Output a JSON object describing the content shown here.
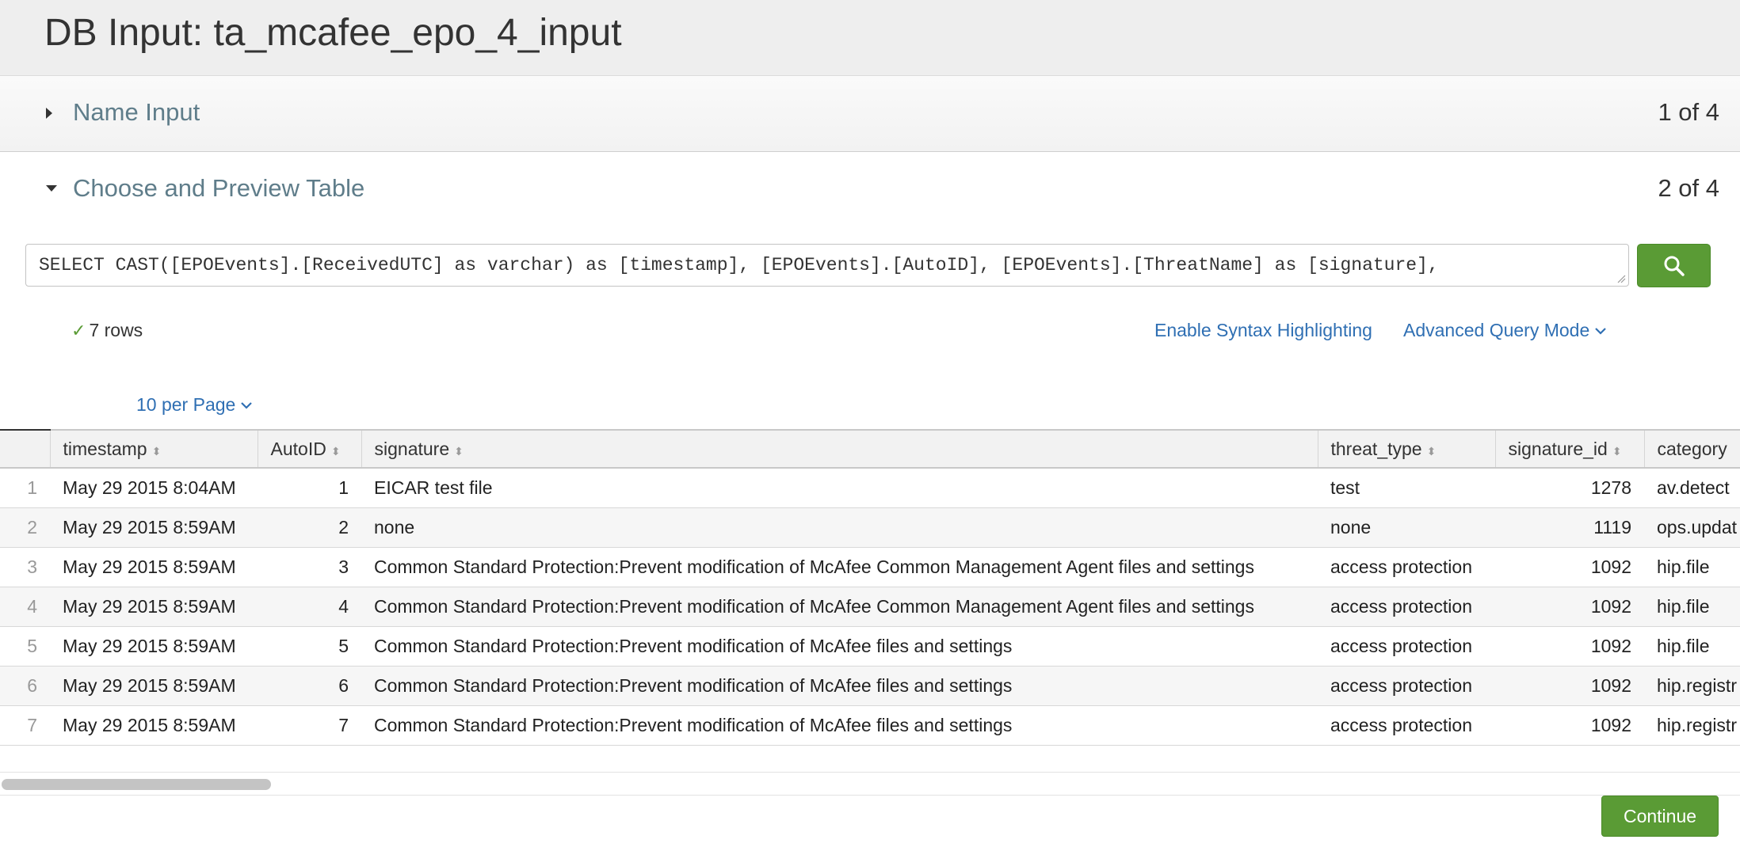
{
  "page": {
    "title": "DB Input: ta_mcafee_epo_4_input"
  },
  "sections": [
    {
      "title": "Name Input",
      "step": "1 of 4",
      "expanded": false
    },
    {
      "title": "Choose and Preview Table",
      "step": "2 of 4",
      "expanded": true
    }
  ],
  "query": {
    "text": "SELECT CAST([EPOEvents].[ReceivedUTC] as varchar) as [timestamp], [EPOEvents].[AutoID], [EPOEvents].[ThreatName] as [signature],",
    "search_icon": "search-icon"
  },
  "status": {
    "rows": "7 rows",
    "icon": "check-icon"
  },
  "links": {
    "syntax": "Enable Syntax Highlighting",
    "advanced": "Advanced Query Mode",
    "per_page": "10 per Page"
  },
  "table": {
    "columns": [
      "timestamp",
      "AutoID",
      "signature",
      "threat_type",
      "signature_id",
      "category"
    ],
    "rows": [
      {
        "n": "1",
        "timestamp": "May 29 2015 8:04AM",
        "autoid": "1",
        "signature": "EICAR test file",
        "threat_type": "test",
        "signature_id": "1278",
        "category": "av.detect"
      },
      {
        "n": "2",
        "timestamp": "May 29 2015 8:59AM",
        "autoid": "2",
        "signature": "none",
        "threat_type": "none",
        "signature_id": "1119",
        "category": "ops.updat"
      },
      {
        "n": "3",
        "timestamp": "May 29 2015 8:59AM",
        "autoid": "3",
        "signature": "Common Standard Protection:Prevent modification of McAfee Common Management Agent files and settings",
        "threat_type": "access protection",
        "signature_id": "1092",
        "category": "hip.file"
      },
      {
        "n": "4",
        "timestamp": "May 29 2015 8:59AM",
        "autoid": "4",
        "signature": "Common Standard Protection:Prevent modification of McAfee Common Management Agent files and settings",
        "threat_type": "access protection",
        "signature_id": "1092",
        "category": "hip.file"
      },
      {
        "n": "5",
        "timestamp": "May 29 2015 8:59AM",
        "autoid": "5",
        "signature": "Common Standard Protection:Prevent modification of McAfee files and settings",
        "threat_type": "access protection",
        "signature_id": "1092",
        "category": "hip.file"
      },
      {
        "n": "6",
        "timestamp": "May 29 2015 8:59AM",
        "autoid": "6",
        "signature": "Common Standard Protection:Prevent modification of McAfee files and settings",
        "threat_type": "access protection",
        "signature_id": "1092",
        "category": "hip.registr"
      },
      {
        "n": "7",
        "timestamp": "May 29 2015 8:59AM",
        "autoid": "7",
        "signature": "Common Standard Protection:Prevent modification of McAfee files and settings",
        "threat_type": "access protection",
        "signature_id": "1092",
        "category": "hip.registr"
      }
    ]
  },
  "buttons": {
    "continue": "Continue"
  },
  "colors": {
    "accent_green": "#5a9b35",
    "link_blue": "#2f6fb3",
    "section_title": "#5f7d8a"
  }
}
